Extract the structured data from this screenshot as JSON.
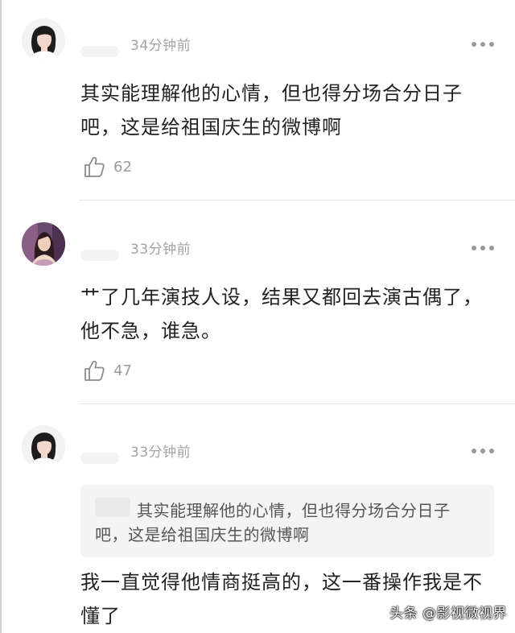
{
  "comments": [
    {
      "time": "34分钟前",
      "text": "其实能理解他的心情，但也得分场合分日子吧，这是给祖国庆生的微博啊",
      "likes": "62",
      "avatar_icon": "avatar-woman-white-top-icon"
    },
    {
      "time": "33分钟前",
      "text": "艹了几年演技人设，结果又都回去演古偶了，他不急，谁急。",
      "likes": "47",
      "avatar_icon": "avatar-woman-dark-hair-icon"
    },
    {
      "time": "33分钟前",
      "quoted": "其实能理解他的心情，但也得分场合分日子吧，这是给祖国庆生的微博啊",
      "text": "我一直觉得他情商挺高的，这一番操作我是不懂了",
      "avatar_icon": "avatar-woman-white-top-icon"
    }
  ],
  "watermark": "头条 @影视微视界",
  "icons": {
    "like": "thumbs-up-outline-icon",
    "more": "more-dots-icon"
  },
  "colors": {
    "text": "#222222",
    "meta": "#a3a3a3",
    "divider": "#e6e6e6",
    "quote_bg": "#f4f4f4"
  }
}
